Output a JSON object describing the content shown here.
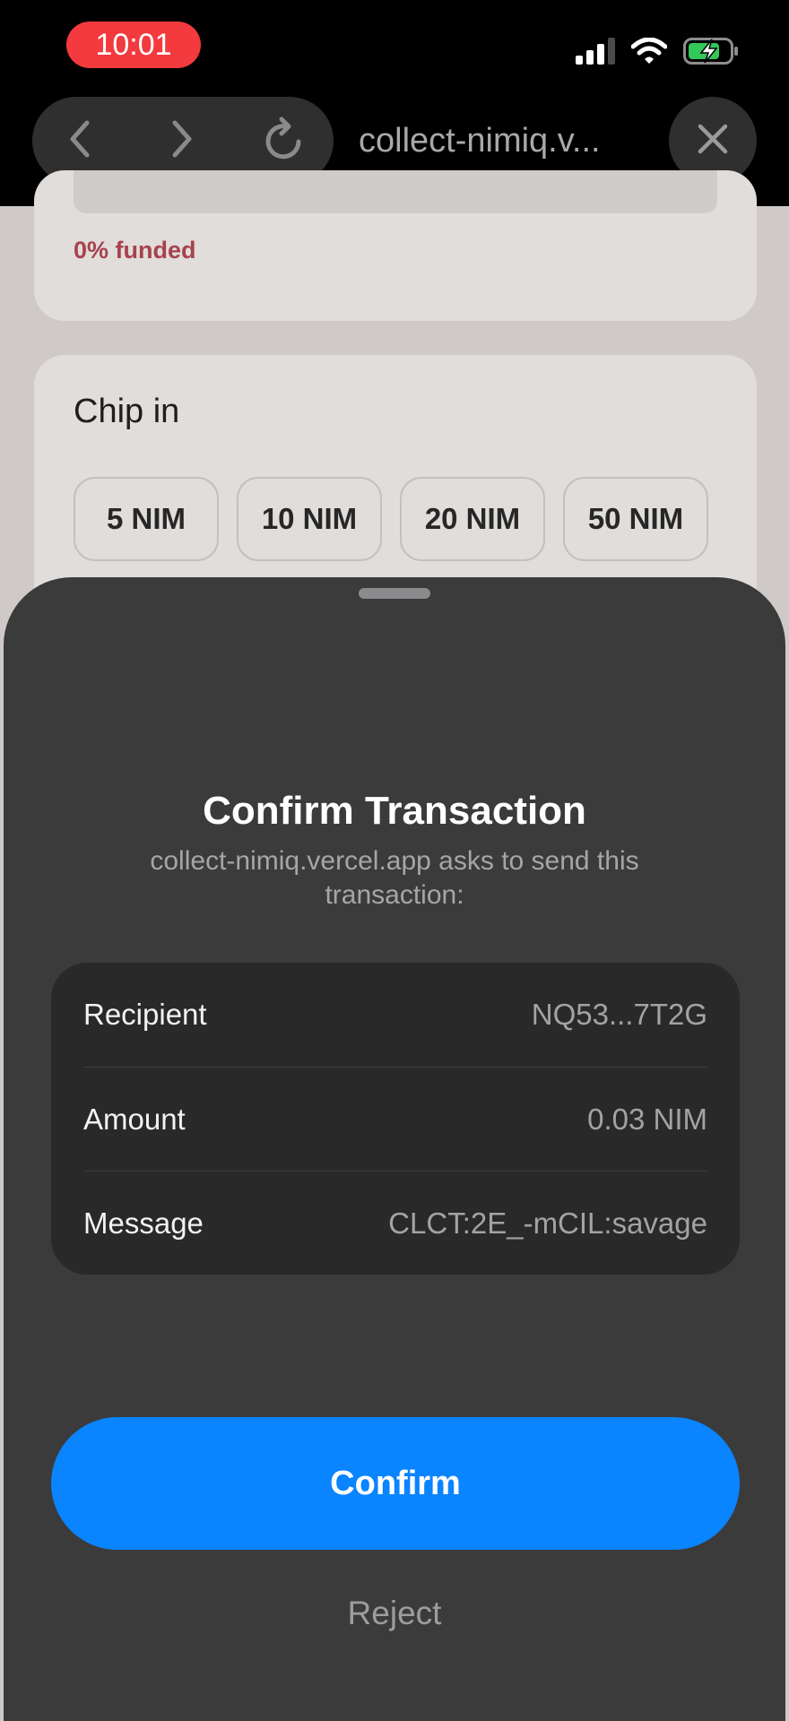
{
  "status_bar": {
    "time": "10:01",
    "icons": [
      "cellular-signal-icon",
      "wifi-icon",
      "battery-charging-icon"
    ]
  },
  "browser": {
    "back_icon": "chevron-left-icon",
    "forward_icon": "chevron-right-icon",
    "reload_icon": "reload-icon",
    "url": "collect-nimiq.v...",
    "close_icon": "close-icon"
  },
  "background_page": {
    "funded_text": "0% funded",
    "chip_in_title": "Chip in",
    "chips": [
      "5 NIM",
      "10 NIM",
      "20 NIM",
      "50 NIM"
    ]
  },
  "sheet": {
    "title": "Confirm Transaction",
    "subtitle": "collect-nimiq.vercel.app asks to send this transaction:",
    "details": [
      {
        "label": "Recipient",
        "value": "NQ53...7T2G"
      },
      {
        "label": "Amount",
        "value": "0.03 NIM"
      },
      {
        "label": "Message",
        "value": "CLCT:2E_-mCIL:savage"
      }
    ],
    "confirm_label": "Confirm",
    "reject_label": "Reject"
  },
  "colors": {
    "accent": "#0a84ff",
    "time_pill": "#f23a3f",
    "funded_text": "#a8424c",
    "battery": "#34c759"
  }
}
